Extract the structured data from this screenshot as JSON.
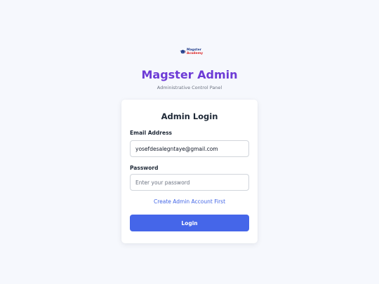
{
  "logo": {
    "line1": "Magster",
    "line2": "Academy",
    "icon": "graduation-cap-icon"
  },
  "header": {
    "title": "Magster Admin",
    "subtitle": "Administrative Control Panel"
  },
  "form": {
    "title": "Admin Login",
    "email_label": "Email Address",
    "email_value": "yosefdesalegntaye@gmail.com",
    "password_label": "Password",
    "password_placeholder": "Enter your password",
    "create_link": "Create Admin Account First",
    "login_label": "Login"
  },
  "colors": {
    "title": "#6d3bd6",
    "accent": "#4566e9",
    "link": "#4366e6",
    "background": "#f6f8fd"
  }
}
